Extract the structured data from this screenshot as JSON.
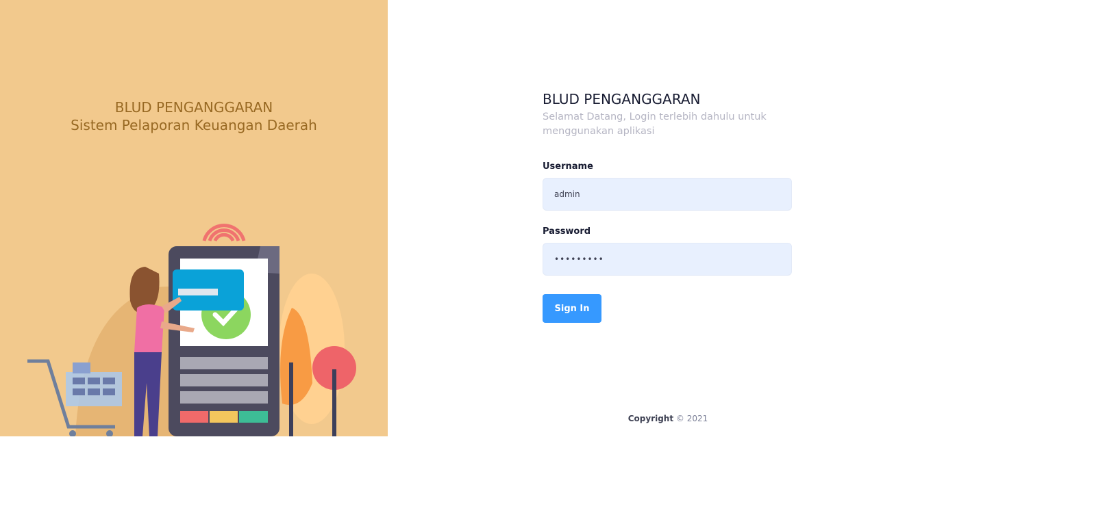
{
  "aside": {
    "title": "BLUD PENGANGGARAN",
    "subtitle": "Sistem Pelaporan Keuangan Daerah",
    "bg_color": "#f2c98d",
    "text_color": "#986923"
  },
  "login": {
    "title": "BLUD PENGANGGARAN",
    "subtitle": "Selamat Datang, Login terlebih dahulu untuk menggunakan aplikasi",
    "username_label": "Username",
    "username_value": "admin",
    "password_label": "Password",
    "password_value": "•••••••••",
    "signin_label": "Sign In",
    "accent_color": "#3699ff"
  },
  "footer": {
    "copyright_label": "Copyright",
    "copyright_text": "© 2021"
  }
}
